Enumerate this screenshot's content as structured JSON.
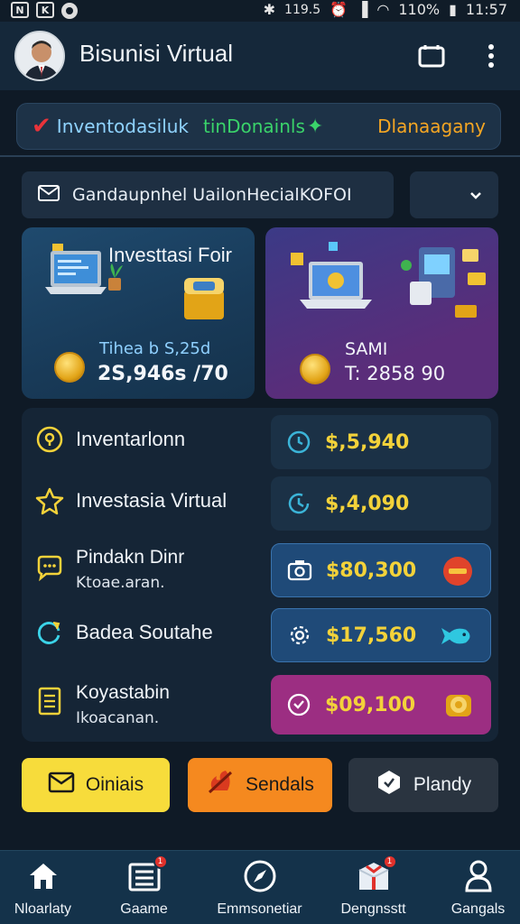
{
  "status_bar": {
    "signal_text": "119.5",
    "battery": "110%",
    "time": "11:57"
  },
  "app": {
    "title": "Bisunisi Virtual"
  },
  "banner": {
    "left_text": "Inventodasiluk",
    "middle_text": "tinDonainls",
    "right_text": "Dlanaagany"
  },
  "dropdown": {
    "value": "Gandaupnhel UailonHecialKOFOI"
  },
  "cards": [
    {
      "title": "Investtasi Foir",
      "subtitle": "Tihea b S,25d",
      "amount": "2S,946s /70"
    },
    {
      "title": "",
      "subtitle": "SAMI",
      "amount": "T: 2858 90"
    }
  ],
  "list": [
    {
      "label": "Inventarlonn",
      "sub": "",
      "value": "$,5,940",
      "icon": "location-pin-icon"
    },
    {
      "label": "Investasia Virtual",
      "sub": "",
      "value": "$,4,090",
      "icon": "star-icon"
    },
    {
      "label": "Pindakn Dinr",
      "sub": "Ktoae.aran.",
      "value": "$80,300",
      "icon": "chat-icon"
    },
    {
      "label": "Badea Soutahe",
      "sub": "",
      "value": "$17,560",
      "icon": "refresh-icon"
    },
    {
      "label": "Koyastabin",
      "sub": "Ikoacanan.",
      "value": "$09,100",
      "icon": "document-icon"
    }
  ],
  "actions": [
    {
      "label": "Oiniais",
      "color": "#f7dc3b"
    },
    {
      "label": "Sendals",
      "color": "#f5891f"
    },
    {
      "label": "Plandy",
      "color": "#2a3440"
    }
  ],
  "nav": [
    {
      "label": "Nloarlaty",
      "icon": "home-icon"
    },
    {
      "label": "Gaame",
      "icon": "list-icon",
      "badge": "1"
    },
    {
      "label": "Emmsonetiar",
      "icon": "compass-icon"
    },
    {
      "label": "Dengnsstt",
      "icon": "gift-icon",
      "badge": "1"
    },
    {
      "label": "Gangals",
      "icon": "person-icon"
    }
  ],
  "colors": {
    "accent_green": "#3ad36a",
    "accent_orange": "#f5a623",
    "value_yellow": "#f3d23a",
    "card_purple": "#5a2d7a"
  }
}
